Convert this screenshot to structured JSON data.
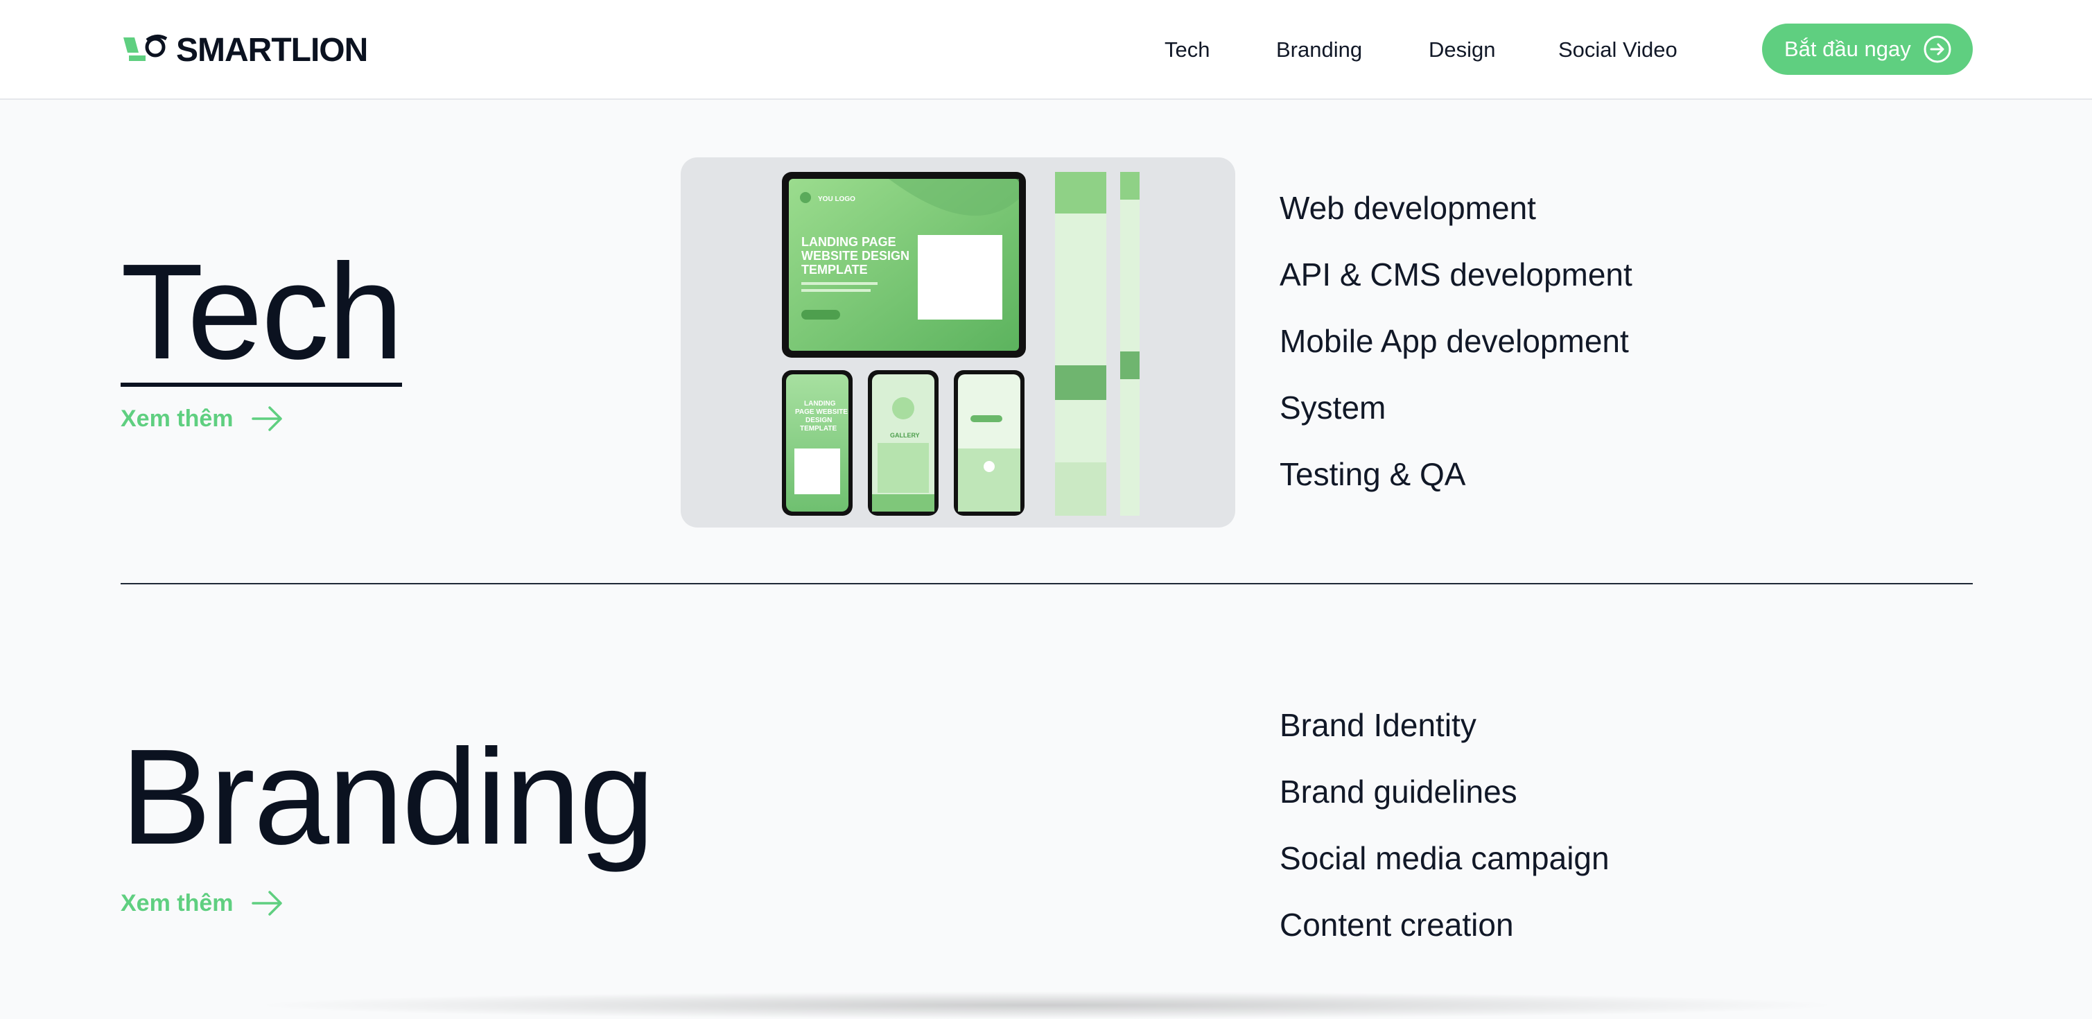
{
  "header": {
    "brand": "SMARTLION",
    "nav": [
      "Tech",
      "Branding",
      "Design",
      "Social Video"
    ],
    "cta_label": "Bắt đầu ngay"
  },
  "sections": [
    {
      "title": "Tech",
      "more_label": "Xem thêm",
      "services": [
        "Web development",
        "API & CMS development",
        "Mobile App development",
        "System",
        "Testing & QA"
      ],
      "mockup": {
        "tablet_headline": [
          "LANDING PAGE",
          "WEBSITE DESIGN",
          "TEMPLATE"
        ],
        "tablet_logo": "YOU LOGO",
        "phone_headline": [
          "LANDING",
          "PAGE WEBSITE",
          "DESIGN",
          "TEMPLATE"
        ],
        "gallery_label": "GALLERY"
      }
    },
    {
      "title": "Branding",
      "more_label": "Xem thêm",
      "services": [
        "Brand Identity",
        "Brand guidelines",
        "Social media campaign",
        "Content creation"
      ]
    }
  ],
  "colors": {
    "accent": "#5fcf80",
    "text": "#0b1220",
    "background": "#f9fafb"
  }
}
